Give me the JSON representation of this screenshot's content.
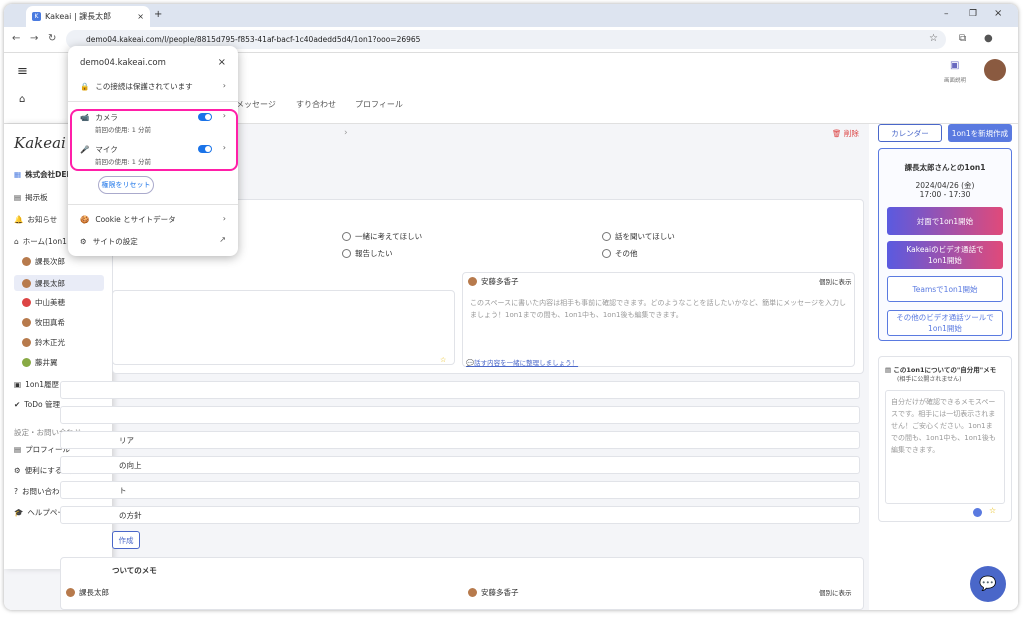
{
  "browser": {
    "tab_title": "Kakeai | 課長太郎",
    "url": "demo04.kakeai.com/l/people/8815d795-f853-41af-bacf-1c40adedd5d4/1on1?ooo=26965"
  },
  "header": {
    "tabs": [
      "メッセージ",
      "すり合わせ",
      "プロフィール"
    ],
    "help": "画面説明",
    "delete": "削除"
  },
  "sidebar": {
    "logo": "Kakeai",
    "company": "株式会社DEM",
    "items": [
      "掲示板",
      "お知らせ",
      "ホーム(1on1"
    ],
    "people": [
      "課長次郎",
      "課長太郎",
      "中山美穂",
      "牧田真希",
      "鈴木正光",
      "藤井翼"
    ],
    "items2": [
      "1on1履歴",
      "ToDo 管理"
    ],
    "section": "設定・お問い合わせ",
    "settings": [
      "プロフィール",
      "便利にする設定",
      "お問い合わせ",
      "ヘルプページ"
    ]
  },
  "main": {
    "options": [
      "一緒に考えてほしい",
      "話を聞いてほしい",
      "報告したい",
      "その他"
    ],
    "partner": "安藤多香子",
    "show_individual": "個別に表示",
    "placeholder": "このスペースに書いた内容は相手も事前に確認できます。どのようなことを話したいかなど、簡単にメッセージを入力しましょう！1on1までの間も、1on1中も、1on1後も編集できます。",
    "organize_link": "話す内容を一緒に整理しましょう！",
    "rows": [
      "リア",
      "の向上",
      "ト",
      "の方針"
    ],
    "create": "作成",
    "memo_title": "ついてのメモ",
    "me": "課長太郎"
  },
  "right": {
    "calendar": "カレンダー",
    "new": "1on1を新規作成",
    "meeting_title": "課長太郎さんとの1on1",
    "date": "2024/04/26 (金)",
    "time": "17:00 - 17:30",
    "btn1": "対面で1on1開始",
    "btn2": "Kakeaiのビデオ通話で1on1開始",
    "btn3": "Teamsで1on1開始",
    "btn4": "その他のビデオ通話ツールで1on1開始",
    "memo_title": "この1on1についての\"自分用\"メモ",
    "memo_sub": "(相手に公開されません)",
    "memo_text": "自分だけが確認できるメモスペースです。相手には一切表示されません！ご安心ください。1on1までの間も、1on1中も、1on1後も編集できます。"
  },
  "popup": {
    "domain": "demo04.kakeai.com",
    "secure": "この接続は保護されています",
    "camera": "カメラ",
    "camera_sub": "前回の使用: 1 分前",
    "mic": "マイク",
    "mic_sub": "前回の使用: 1 分前",
    "reset": "権限をリセット",
    "cookie": "Cookie とサイトデータ",
    "settings": "サイトの設定"
  }
}
